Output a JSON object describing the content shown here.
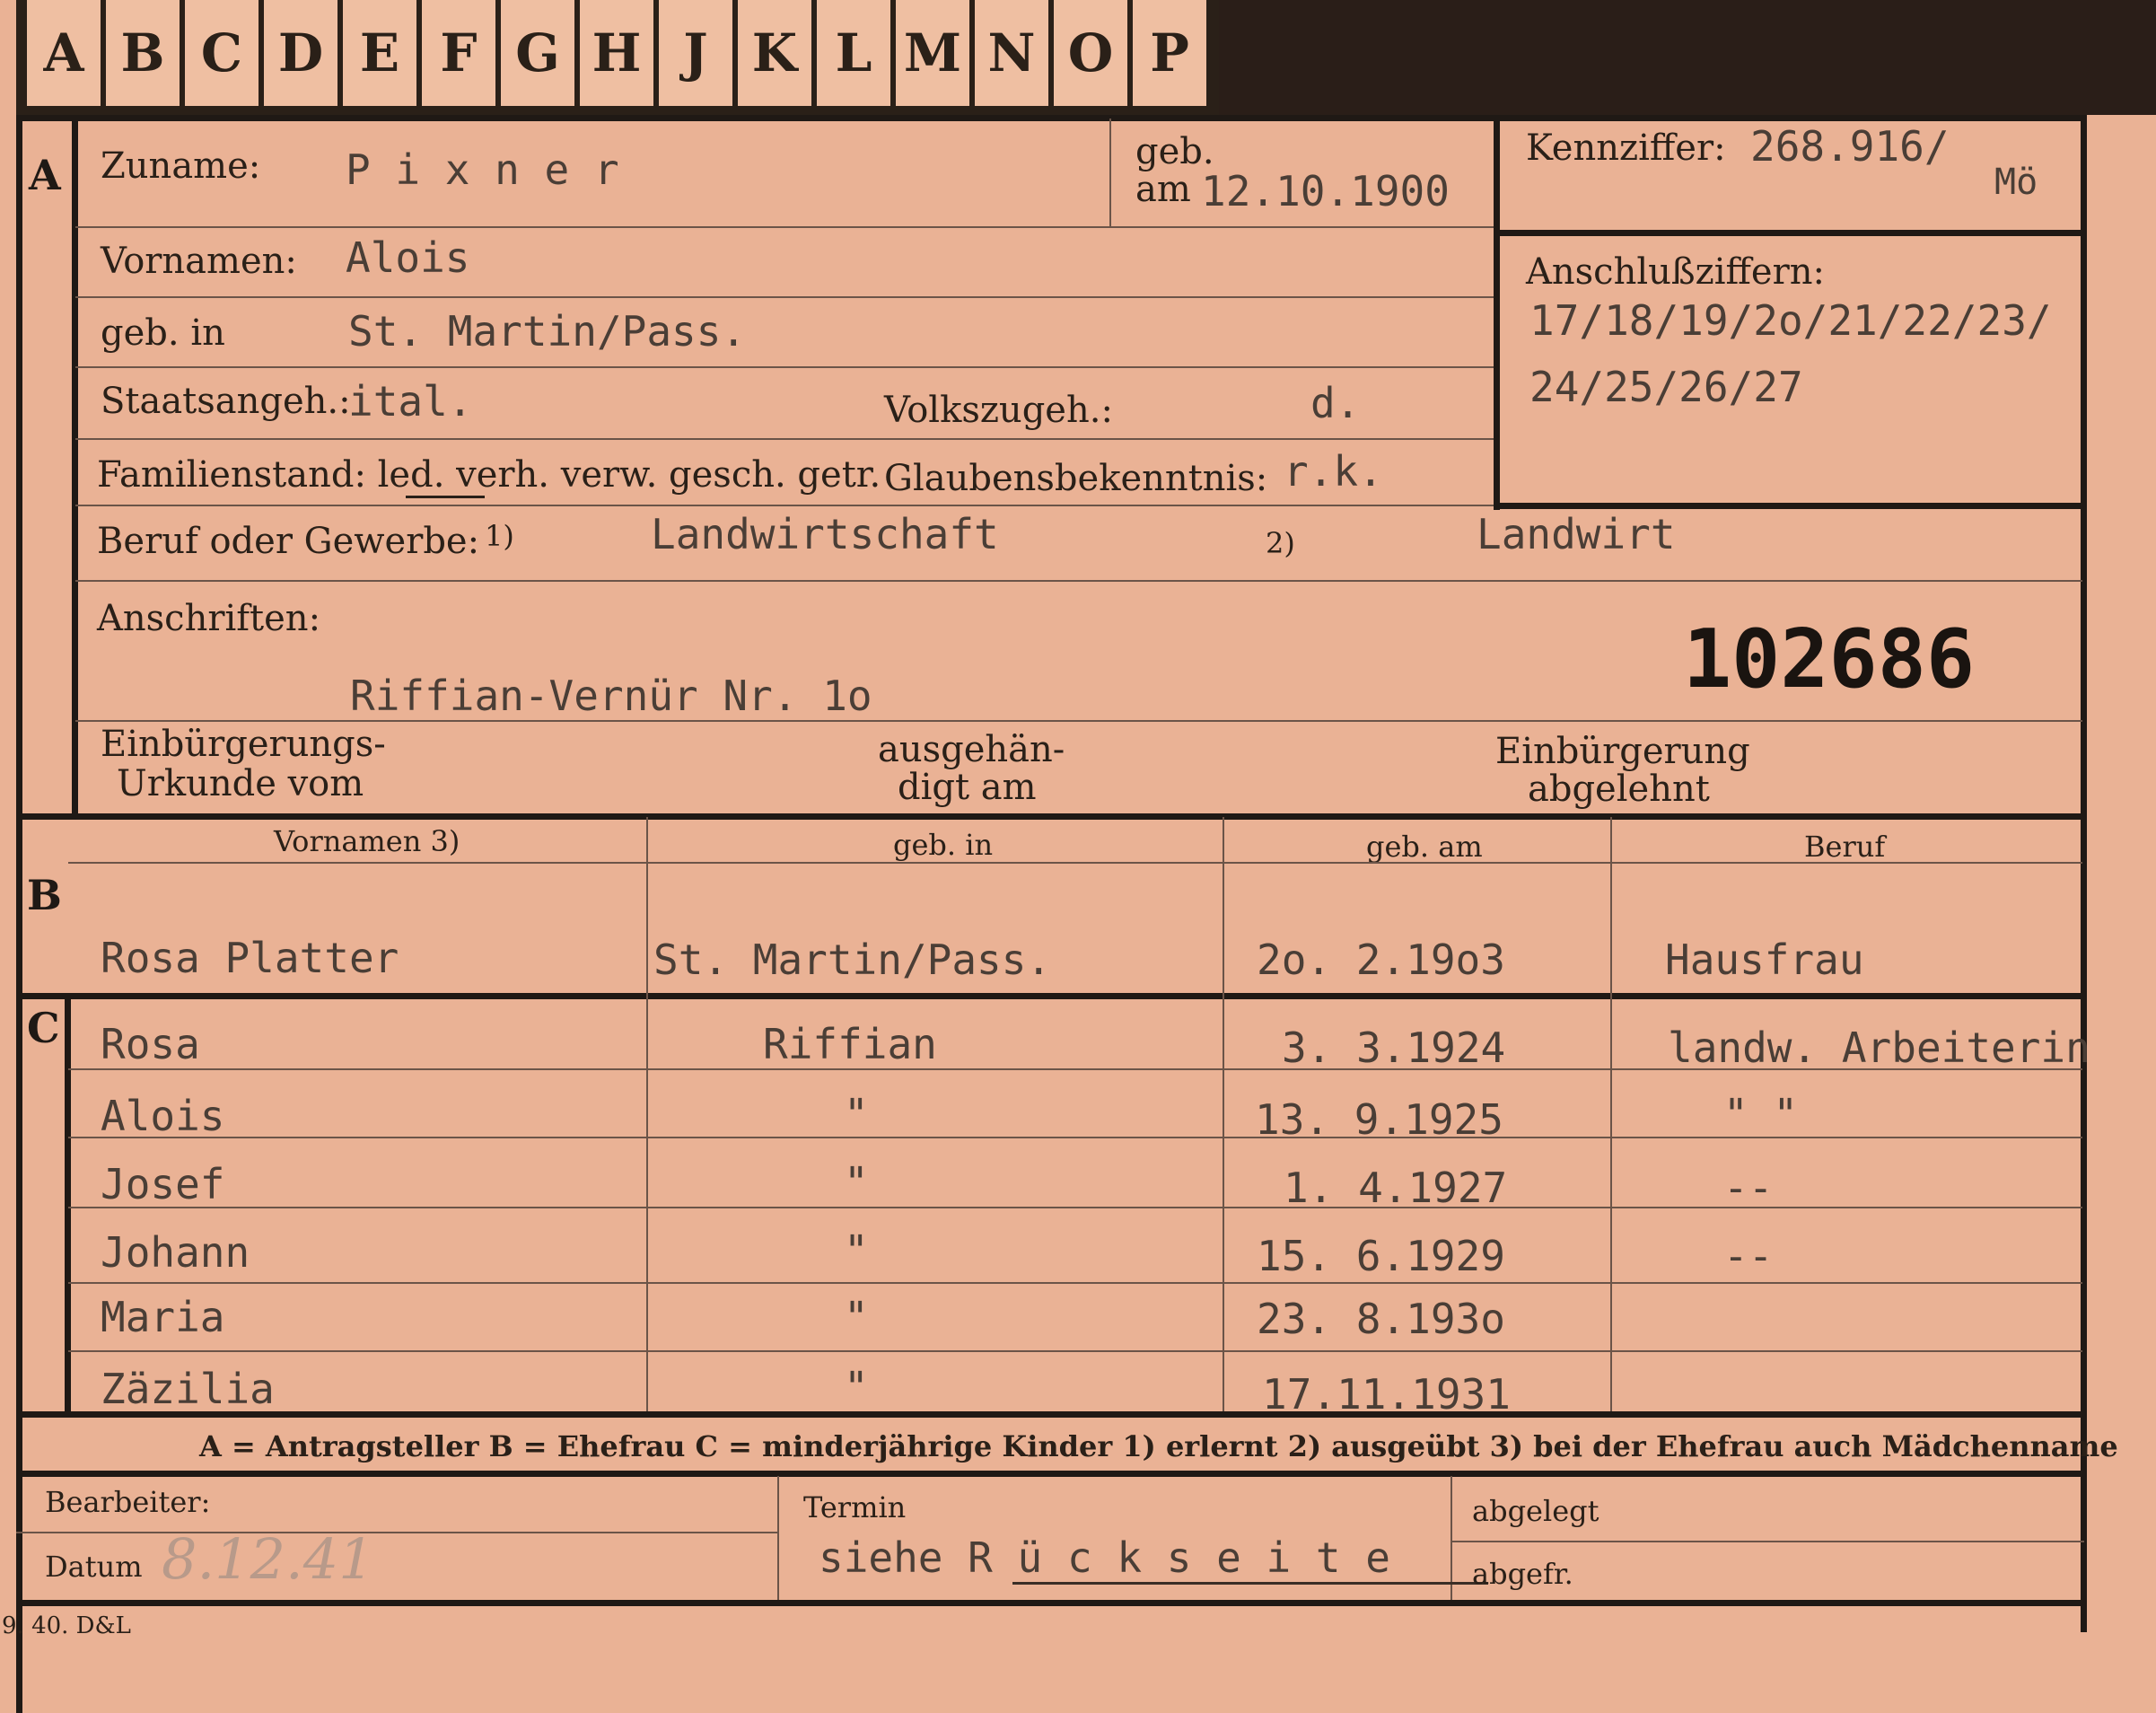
{
  "tabs": [
    "A",
    "B",
    "C",
    "D",
    "E",
    "F",
    "G",
    "H",
    "J",
    "K",
    "L",
    "M",
    "N",
    "O",
    "P"
  ],
  "sections": {
    "a": "A",
    "b": "B",
    "c": "C"
  },
  "applicant": {
    "surname_label": "Zuname:",
    "surname": "P i x n e r",
    "born_label_1": "geb.",
    "born_label_2": "am",
    "born_date": "12.10.1900",
    "firstnames_label": "Vornamen:",
    "firstnames": "Alois",
    "birthplace_label": "geb. in",
    "birthplace": "St. Martin/Pass.",
    "citizenship_label": "Staatsangeh.:",
    "citizenship": "ital.",
    "ethnicity_label": "Volkszugeh.:",
    "ethnicity": "d.",
    "marital_label": "Familienstand: led. verh. verw. gesch. getr.",
    "religion_label": "Glaubensbekenntnis:",
    "religion": "r.k.",
    "occupation_label": "Beruf oder Gewerbe:",
    "occ_note1": "1)",
    "occupation_learned": "Landwirtschaft",
    "occ_note2": "2)",
    "occupation_practiced": "Landwirt",
    "address_label": "Anschriften:",
    "address": "Riffian-Vernür Nr. 1o",
    "number": "102686",
    "naturalization_label_1": "Einbürgerungs-",
    "naturalization_label_2": "Urkunde vom",
    "handed_label_1": "ausgehän-",
    "handed_label_2": "digt am",
    "rejected_label_1": "Einbürgerung",
    "rejected_label_2": "abgelehnt"
  },
  "reference": {
    "code_label": "Kennziffer:",
    "code": "268.916/",
    "code_suffix": "Mö",
    "connected_label": "Anschlußziffern:",
    "connected_line1": "17/18/19/2o/21/22/23/",
    "connected_line2": "24/25/26/27"
  },
  "spouse": {
    "headers": [
      "Vornamen 3)",
      "geb. in",
      "geb. am",
      "Beruf"
    ],
    "name": "Rosa Platter",
    "birthplace": "St. Martin/Pass.",
    "birthdate": "2o. 2.19o3",
    "occupation": "Hausfrau"
  },
  "children": [
    {
      "name": "Rosa",
      "place": "Riffian",
      "date": "3. 3.1924",
      "job": "landw. Arbeiterin"
    },
    {
      "name": "Alois",
      "place": "\"",
      "date": "13. 9.1925",
      "job": "\"          \""
    },
    {
      "name": "Josef",
      "place": "\"",
      "date": "1. 4.1927",
      "job": "--"
    },
    {
      "name": "Johann",
      "place": "\"",
      "date": "15. 6.1929",
      "job": "--"
    },
    {
      "name": "Maria",
      "place": "\"",
      "date": "23. 8.193o",
      "job": ""
    },
    {
      "name": "Zäzilia",
      "place": "\"",
      "date": "17.11.1931",
      "job": ""
    }
  ],
  "legend": "A = Antragsteller   B = Ehefrau   C = minderjährige Kinder   1) erlernt   2) ausgeübt   3) bei der Ehefrau auch Mädchenname",
  "footer": {
    "clerk_label": "Bearbeiter:",
    "date_label": "Datum",
    "date_value": "8.12.41",
    "term_label": "Termin",
    "term_value": "siehe  R ü c k s e i t e",
    "filed_label": "abgelegt",
    "sent_label": "abgefr."
  },
  "printer": "9. 40. D&L"
}
